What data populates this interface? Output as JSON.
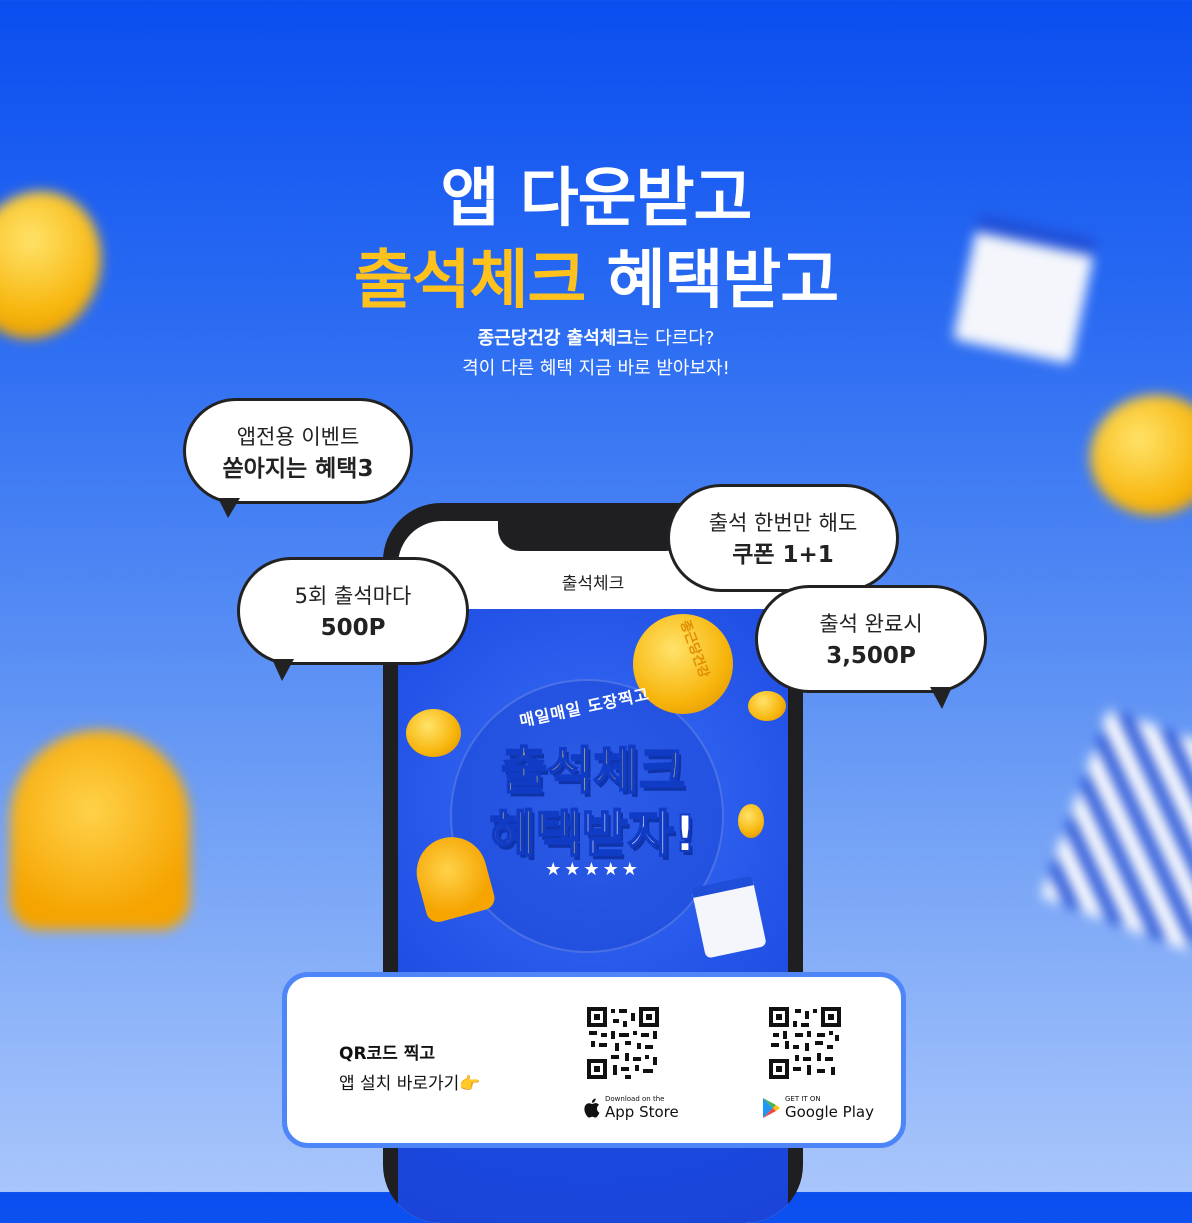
{
  "headline": {
    "line1": "앱 다운받고",
    "line2_highlight": "출석체크",
    "line2_rest": "혜택받고"
  },
  "subtitle": {
    "line1_bold": "종근당건강 출석체크",
    "line1_rest": "는 다르다?",
    "line2": "격이 다른 혜택 지금 바로 받아보자!"
  },
  "bubbles": [
    {
      "line1": "앱전용 이벤트",
      "line2": "쏟아지는 혜택3"
    },
    {
      "line1": "5회 출석마다",
      "line2": "500P"
    },
    {
      "line1": "출석 한번만 해도",
      "line2": "쿠폰 1+1"
    },
    {
      "line1": "출석 완료시",
      "line2": "3,500P"
    }
  ],
  "phone": {
    "screen_title": "출석체크",
    "banner": {
      "small": "매일매일 도장찍고",
      "big1": "출석체크",
      "big2_a": "혜택",
      "big2_b": "받자!",
      "stars": "★★★★★",
      "stamp_text": "종근당건강"
    }
  },
  "qr_card": {
    "title": "QR코드 찍고",
    "subtitle": "앱 설치 바로가기👉",
    "app_store": {
      "small": "Download on the",
      "big": "App Store"
    },
    "google_play": {
      "small": "GET IT ON",
      "big": "Google Play"
    }
  },
  "colors": {
    "highlight": "#ffc21d",
    "card_border": "#4e86f7",
    "banner_blue": "#1b49e0"
  },
  "icons": [
    "apple-icon",
    "google-play-icon",
    "qr-code-icon",
    "coin-icon",
    "bell-icon",
    "gift-icon"
  ]
}
